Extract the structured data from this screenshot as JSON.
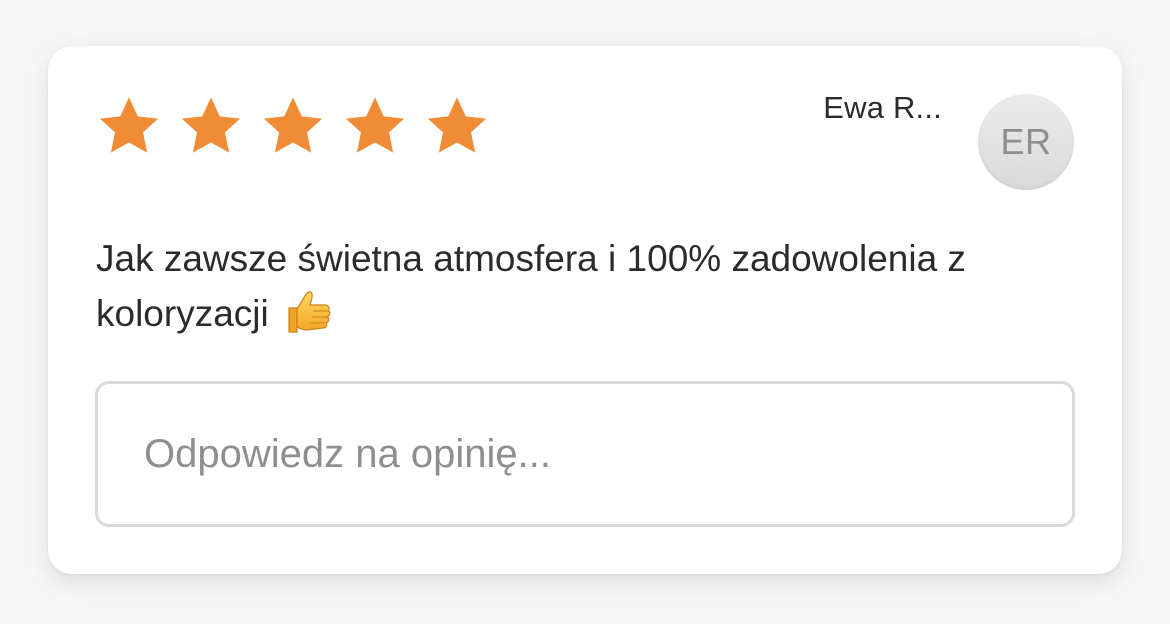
{
  "review": {
    "rating": 5,
    "rating_max": 5,
    "star_color": "#f08c35",
    "author_name": "Ewa R...",
    "author_initials": "ER",
    "text": "Jak zawsze świetna atmosfera i 100% zadowolenia z koloryzacji",
    "emoji": "thumbs-up-icon"
  },
  "reply": {
    "placeholder": "Odpowiedz na opinię...",
    "value": ""
  }
}
